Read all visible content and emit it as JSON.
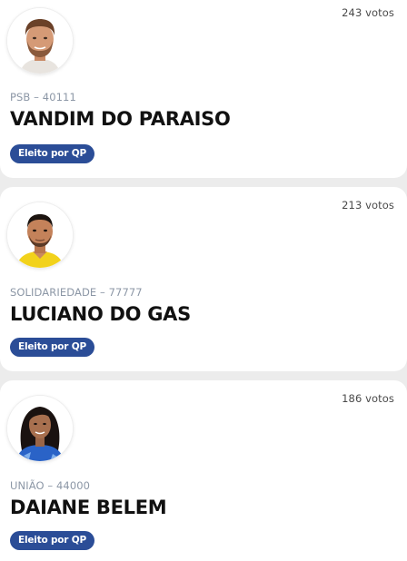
{
  "candidates": [
    {
      "votes": "243 votos",
      "party": "PSB – 40111",
      "name": "VANDIM DO PARAISO",
      "status": "Eleito por QP",
      "photo": "candidate-photo-man-beard"
    },
    {
      "votes": "213 votos",
      "party": "SOLIDARIEDADE – 77777",
      "name": "LUCIANO DO GAS",
      "status": "Eleito por QP",
      "photo": "candidate-photo-man-yellow-shirt"
    },
    {
      "votes": "186 votos",
      "party": "UNIÃO – 44000",
      "name": "DAIANE BELEM",
      "status": "Eleito por QP",
      "photo": "candidate-photo-woman-blue-shirt"
    }
  ],
  "colors": {
    "badge_bg": "#2b4d97",
    "badge_text": "#ffffff",
    "party_text": "#8c97a6",
    "name_text": "#111111",
    "page_bg": "#ececec"
  }
}
